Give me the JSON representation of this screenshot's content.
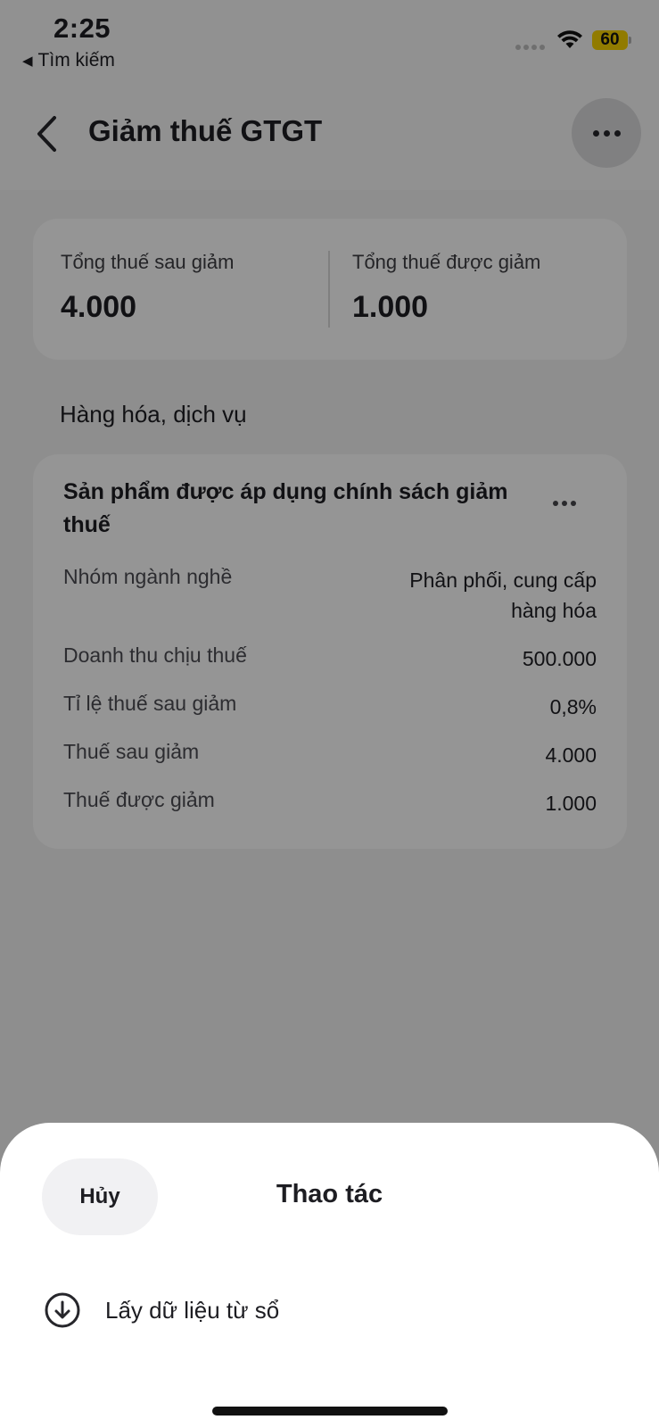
{
  "status_bar": {
    "time": "2:25",
    "back_app": "Tìm kiếm",
    "back_app_icon": "triangle-left-icon",
    "battery_level": "60",
    "battery_color": "#f2cd00"
  },
  "nav": {
    "title": "Giảm thuế GTGT",
    "back_icon": "chevron-left-icon",
    "more_icon": "more-horizontal-icon"
  },
  "summary": {
    "after_label": "Tổng thuế sau giảm",
    "after_value": "4.000",
    "reduced_label": "Tổng thuế được giảm",
    "reduced_value": "1.000"
  },
  "section_title": "Hàng hóa, dịch vụ",
  "product": {
    "title": "Sản phẩm được áp dụng chính sách giảm thuế",
    "rows": [
      {
        "label": "Nhóm ngành nghề",
        "value": "Phân phối, cung cấp hàng hóa"
      },
      {
        "label": "Doanh thu chịu thuế",
        "value": "500.000"
      },
      {
        "label": "Tỉ lệ thuế sau giảm",
        "value": "0,8%"
      },
      {
        "label": "Thuế sau giảm",
        "value": "4.000"
      },
      {
        "label": "Thuế được giảm",
        "value": "1.000"
      }
    ]
  },
  "sheet": {
    "cancel_label": "Hủy",
    "title": "Thao tác",
    "actions": [
      {
        "label": "Lấy dữ liệu từ sổ",
        "icon": "download-circle-icon"
      }
    ]
  }
}
